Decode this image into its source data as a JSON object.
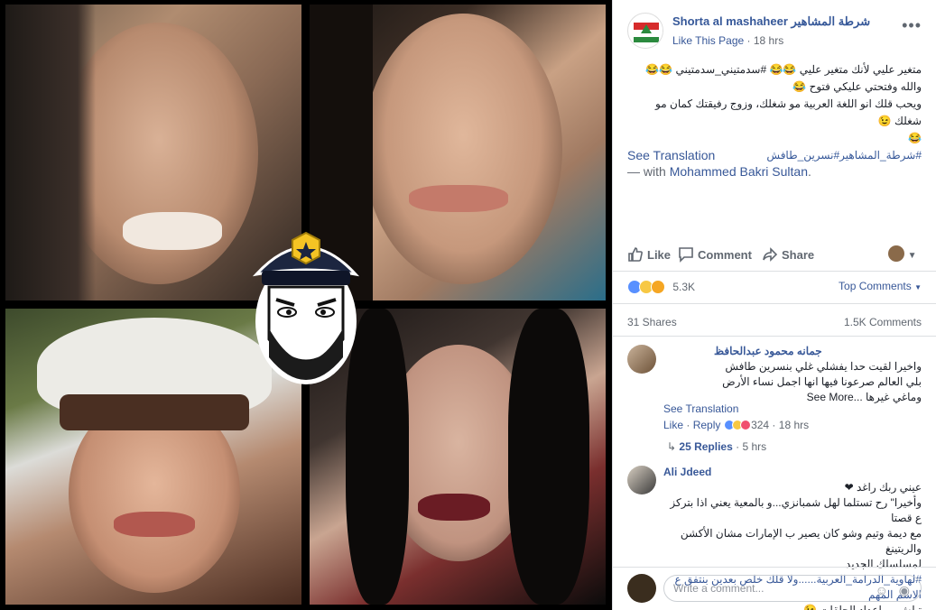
{
  "page": {
    "name": "Shorta al mashaheer شرطة المشاهير",
    "like_label": "Like This Page",
    "dot": "·",
    "time": "18 hrs",
    "more": "•••"
  },
  "post": {
    "line1": "متغير عليي لأنك متغير عليي 😂😂 #سدمتيني_سدمتيني 😂😂 والله وفتحتي عليكي فتوح 😂",
    "line2": "ويحب قلك انو اللغة العربية مو شغلك، وزوج رفيقتك كمان مو شغلك 😉",
    "line3": "😂",
    "hashtags": "#شرطة_المشاهير#نسرين_طافش",
    "see_translation": "See Translation",
    "with_prefix": "— with ",
    "with_name": "Mohammed Bakri Sultan",
    "with_suffix": "."
  },
  "actions": {
    "like": "Like",
    "comment": "Comment",
    "share": "Share"
  },
  "reactions": {
    "count": "5.3K",
    "top_comments": "Top Comments",
    "shares": "31 Shares",
    "comments": "1.5K Comments"
  },
  "comments": [
    {
      "name": "جمانه محمود عبدالحافظ",
      "lines": [
        "واخيرا لقيت حدا يفشلي غلي بنسرين طافش",
        "بلي العالم صرعونا فيها انها اجمل نساء الأرض",
        "وماغي غيرها ...See More"
      ],
      "see_translation": "See Translation",
      "like": "Like",
      "reply": "Reply",
      "reacts": "324",
      "time": "18 hrs",
      "replies": "25 Replies",
      "replies_time": "5 hrs"
    },
    {
      "name": "Ali Jdeed",
      "lines": [
        "عيني ربك راغد ❤",
        "وأخيرا\" رح تستلما لهل شمبانزي...و بالمعية يعني اذا بتركز ع قصتا",
        "مع ديمة وتيم وشو كان يصير ب الإمارات مشان الأكشن والريتينغ",
        "لمسلسلك الجديد",
        "#لهاوية_الدرامة_العربية......ولا قلك خلص بعدين بنتفق ع الاسم المهم",
        "تبلش ب اعداد الحلقات 😉"
      ]
    }
  ],
  "write": {
    "placeholder": "Write a comment..."
  }
}
